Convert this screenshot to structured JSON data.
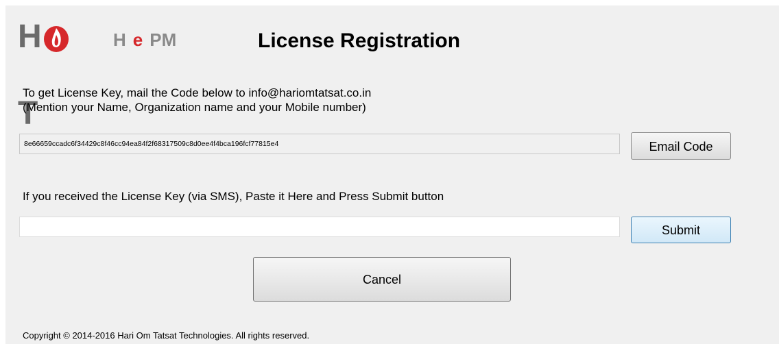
{
  "logo": {
    "hot_left": "H",
    "hot_right": "T",
    "flame_icon": "flame-icon",
    "hepm_h": "H",
    "hepm_e": "e",
    "hepm_pm": "PM"
  },
  "title": "License Registration",
  "instructions": {
    "line1": "To get License Key, mail the Code below to info@hariomtatsat.co.in",
    "line2": "(Mention your Name, Organization name and your Mobile number)"
  },
  "code": "8e66659ccadc6f34429c8f46cc94ea84f2f68317509c8d0ee4f4bca196fcf77815e4",
  "email_button": "Email Code",
  "prompt": "If you received the License Key (via SMS), Paste it Here and Press Submit button",
  "license_key": {
    "value": "",
    "placeholder": ""
  },
  "submit_button": "Submit",
  "cancel_button": "Cancel",
  "copyright": "Copyright © 2014-2016 Hari Om Tatsat Technologies. All rights reserved.",
  "colors": {
    "window_bg": "#f0f0f0",
    "logo_gray": "#6b6b6b",
    "logo_red": "#d6282b",
    "submit_border": "#3c7fb1"
  }
}
